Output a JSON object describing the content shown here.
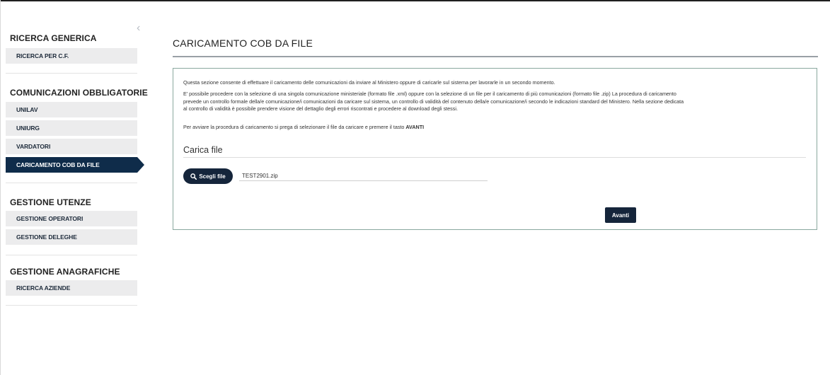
{
  "sidebar": {
    "collapse_icon": "chevron-left-icon",
    "sections": [
      {
        "title": "RICERCA GENERICA",
        "items": [
          "RICERCA PER C.F."
        ]
      },
      {
        "title": "COMUNICAZIONI OBBLIGATORIE",
        "items": [
          "UNILAV",
          "UNIURG",
          "VARDATORI",
          "CARICAMENTO COB DA FILE"
        ]
      },
      {
        "title": "GESTIONE UTENZE",
        "items": [
          "GESTIONE OPERATORI",
          "GESTIONE DELEGHE"
        ]
      },
      {
        "title": "GESTIONE ANAGRAFICHE",
        "items": [
          "RICERCA AZIENDE"
        ]
      }
    ],
    "active_item": "CARICAMENTO COB DA FILE"
  },
  "main": {
    "title": "CARICAMENTO COB DA FILE",
    "intro": "Questa sezione consente di effettuare il caricamento delle comunicazioni da inviare al Ministero oppure di caricarle sul sistema per lavorarle in un secondo momento.",
    "description_1": "E' possibile procedere con la selezione di una singola comunicazione ministeriale (formato file .xml) oppure con la selezione di un file per il caricamento di più comunicazioni (formato file .zip) La procedura di caricamento",
    "description_2": "prevede un controllo formale della/e comunicazione/i comunicazioni da caricare sul sistema, un controllo di validità del contenuto della/e comunicazione/i secondo le indicazioni standard del Ministero. Nella sezione dedicata",
    "description_3": "al controllo di validità è possibile prendere visione del dettaglio degli errori riscontrati e procedere al download degli stessi.",
    "instruction_prefix": "Per avviare la procedura di caricamento si prega di selezionare il file da caricare e premere il tasto ",
    "instruction_bold": "AVANTI",
    "upload_title": "Carica file",
    "choose_button": "Scegli file",
    "choose_icon": "search-icon",
    "file_name": "TEST2901.zip",
    "next_button": "Avanti"
  }
}
